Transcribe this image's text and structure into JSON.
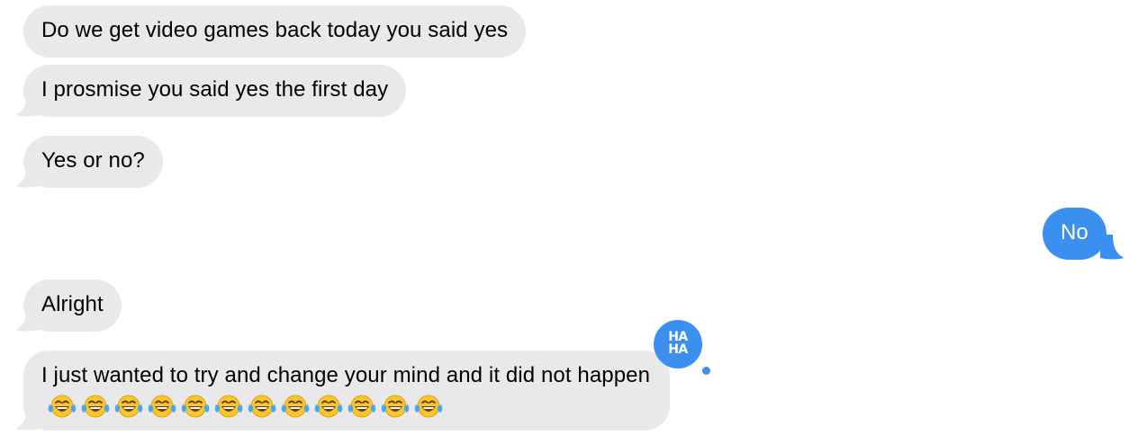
{
  "colors": {
    "incoming_bubble": "#e9e9eb",
    "outgoing_bubble": "#3b8fef",
    "tapback": "#3b8fef"
  },
  "messages": [
    {
      "direction": "incoming",
      "text": "Do we get video games back today you said yes"
    },
    {
      "direction": "incoming",
      "text": "I prosmise you said yes the first day"
    },
    {
      "direction": "incoming",
      "text": "Yes or no?"
    },
    {
      "direction": "outgoing",
      "text": "No"
    },
    {
      "direction": "incoming",
      "text": "Alright"
    },
    {
      "direction": "incoming",
      "text": "I just wanted to try and change your mind and it did not happen",
      "emoji": "face-with-tears-of-joy",
      "emoji_count": 12
    }
  ],
  "tapback": {
    "icon": "haha-icon",
    "line1": "HA",
    "line2": "HA"
  }
}
